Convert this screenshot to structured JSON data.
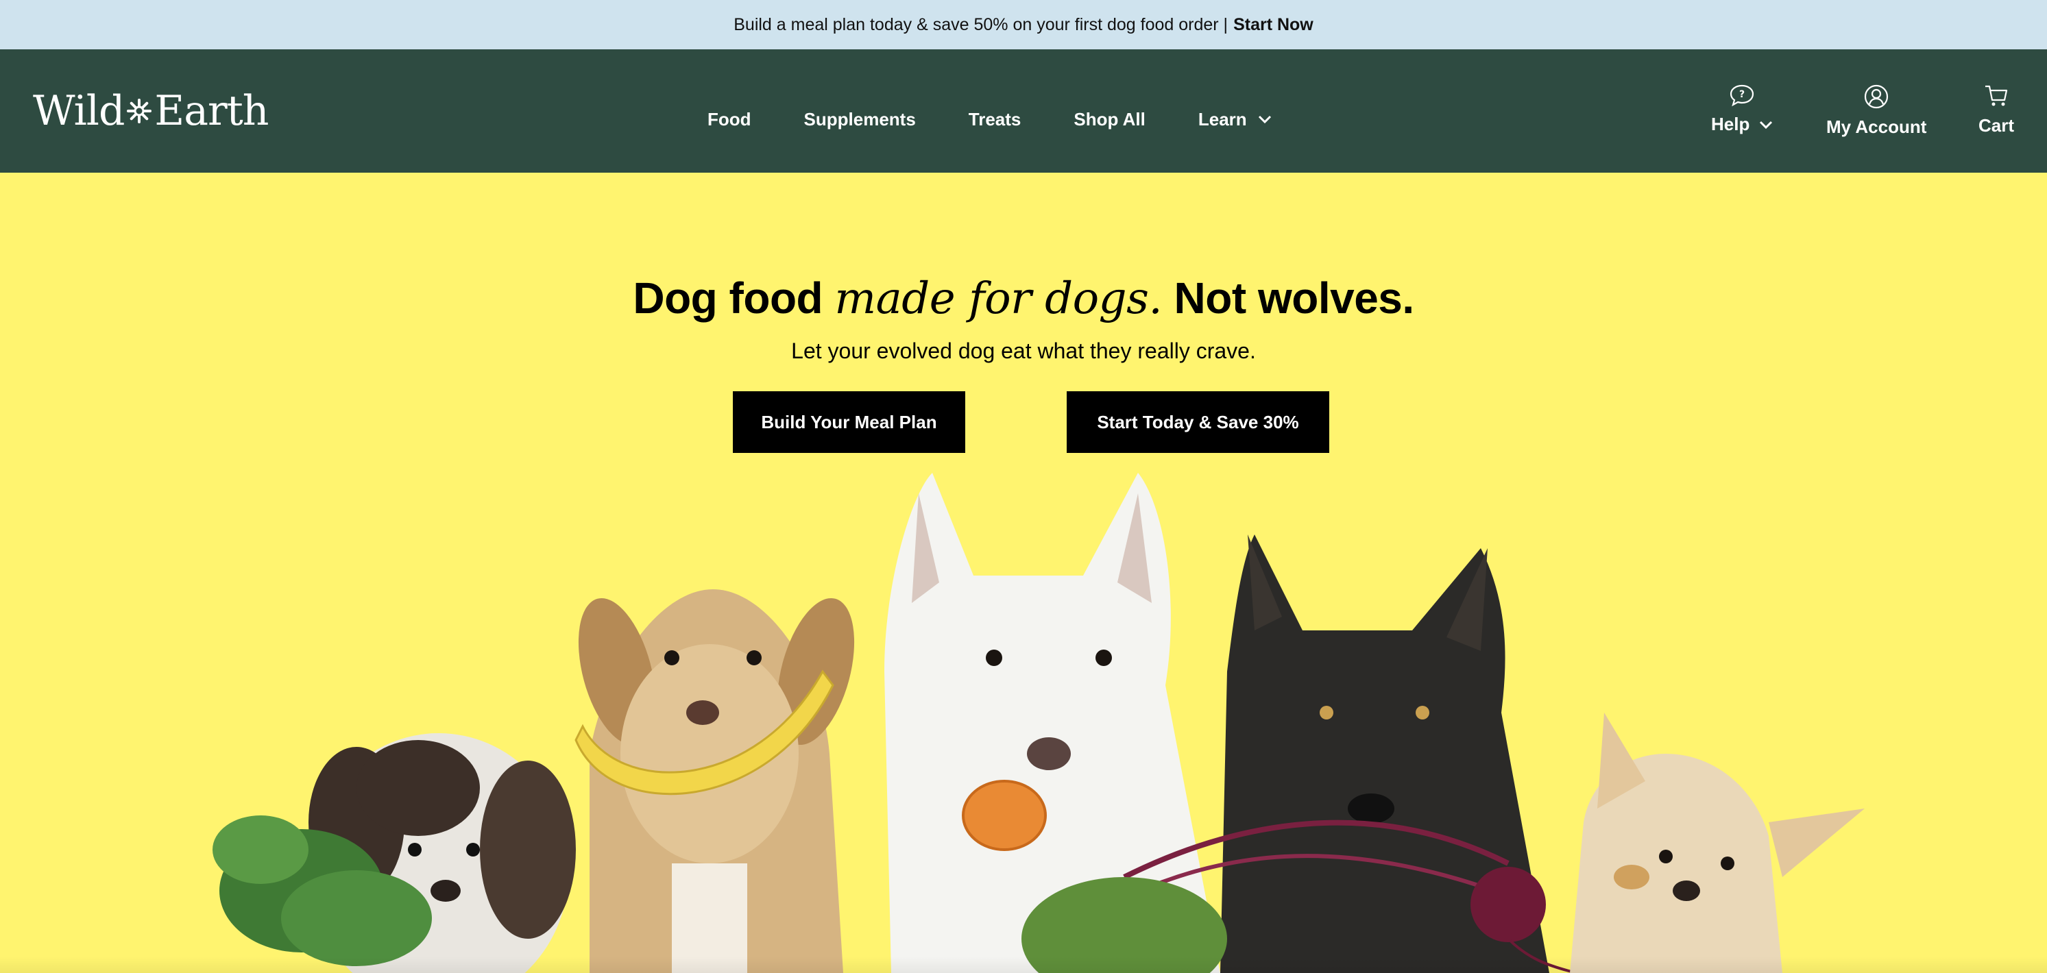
{
  "announcement": {
    "text": "Build a meal plan today & save 50% on your first dog food order |",
    "cta": "Start Now"
  },
  "header": {
    "logo": {
      "part1": "Wild",
      "part2": "Earth"
    },
    "nav": [
      {
        "label": "Food"
      },
      {
        "label": "Supplements"
      },
      {
        "label": "Treats"
      },
      {
        "label": "Shop All"
      },
      {
        "label": "Learn"
      }
    ],
    "utilities": {
      "help": "Help",
      "account": "My Account",
      "cart": "Cart"
    }
  },
  "hero": {
    "title_bold_1": "Dog food",
    "title_italic": "made for dogs.",
    "title_bold_2": "Not wolves.",
    "subtitle": "Let your evolved dog eat what they really crave.",
    "buttons": {
      "meal_plan": "Build Your Meal Plan",
      "start_today": "Start Today & Save 30%"
    }
  },
  "colors": {
    "announcement_bg": "#cfe3ee",
    "header_bg": "#2e4b41",
    "hero_bg": "#fff46f",
    "button_bg": "#000000"
  }
}
